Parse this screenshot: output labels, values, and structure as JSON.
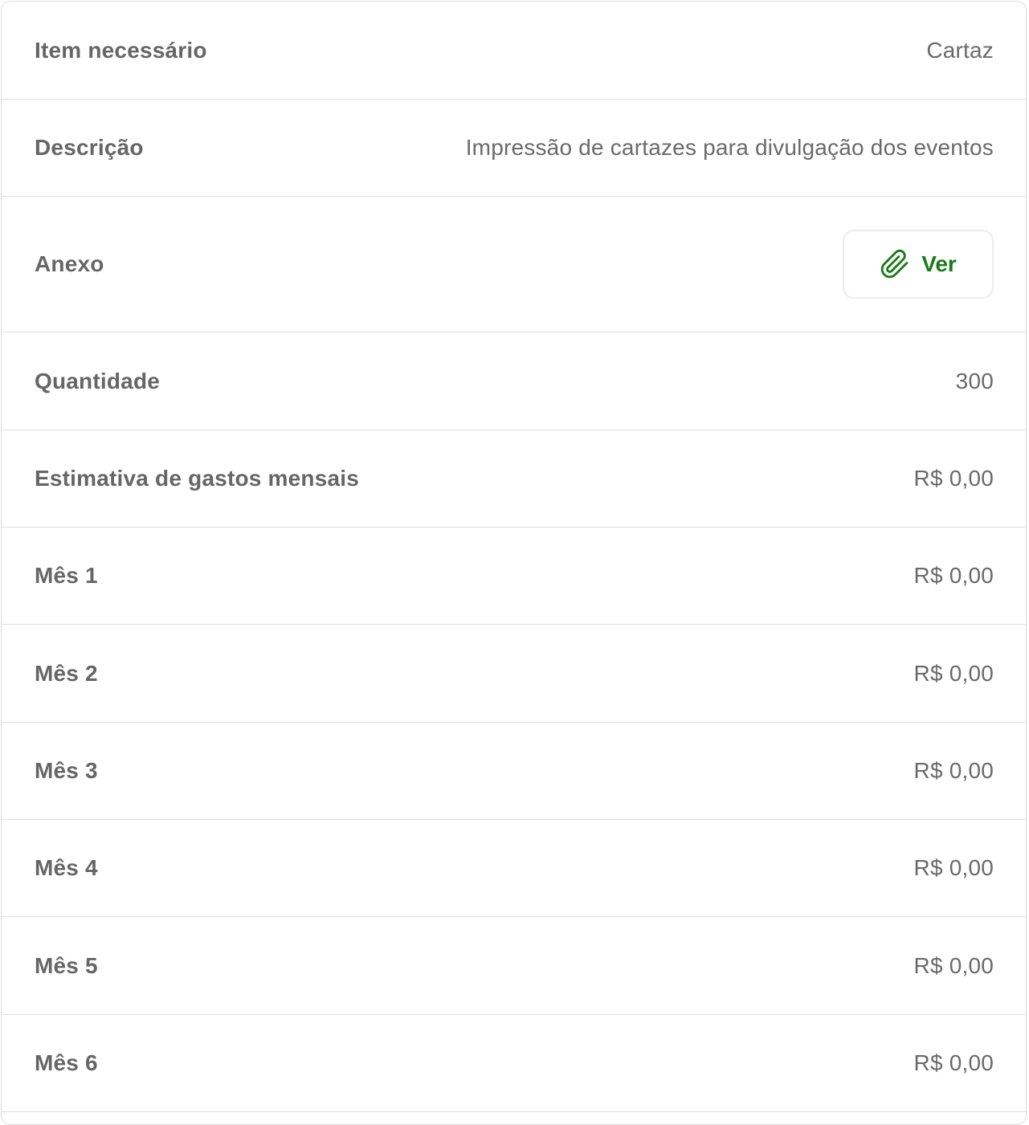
{
  "rows": {
    "item": {
      "label": "Item necessário",
      "value": "Cartaz"
    },
    "description": {
      "label": "Descrição",
      "value": "Impressão de cartazes para divulgação dos eventos"
    },
    "attachment": {
      "label": "Anexo",
      "button_label": "Ver",
      "button_icon": "paperclip-icon"
    },
    "quantity": {
      "label": "Quantidade",
      "value": "300"
    },
    "monthly_estimate": {
      "label": "Estimativa de gastos mensais",
      "value": "R$ 0,00"
    },
    "months": [
      {
        "label": "Mês 1",
        "value": "R$ 0,00"
      },
      {
        "label": "Mês 2",
        "value": "R$ 0,00"
      },
      {
        "label": "Mês 3",
        "value": "R$ 0,00"
      },
      {
        "label": "Mês 4",
        "value": "R$ 0,00"
      },
      {
        "label": "Mês 5",
        "value": "R$ 0,00"
      },
      {
        "label": "Mês 6",
        "value": "R$ 0,00"
      }
    ]
  },
  "colors": {
    "label": "#666666",
    "value": "#6a6a6a",
    "accent_green": "#1a7a1a",
    "divider": "#dedede"
  }
}
